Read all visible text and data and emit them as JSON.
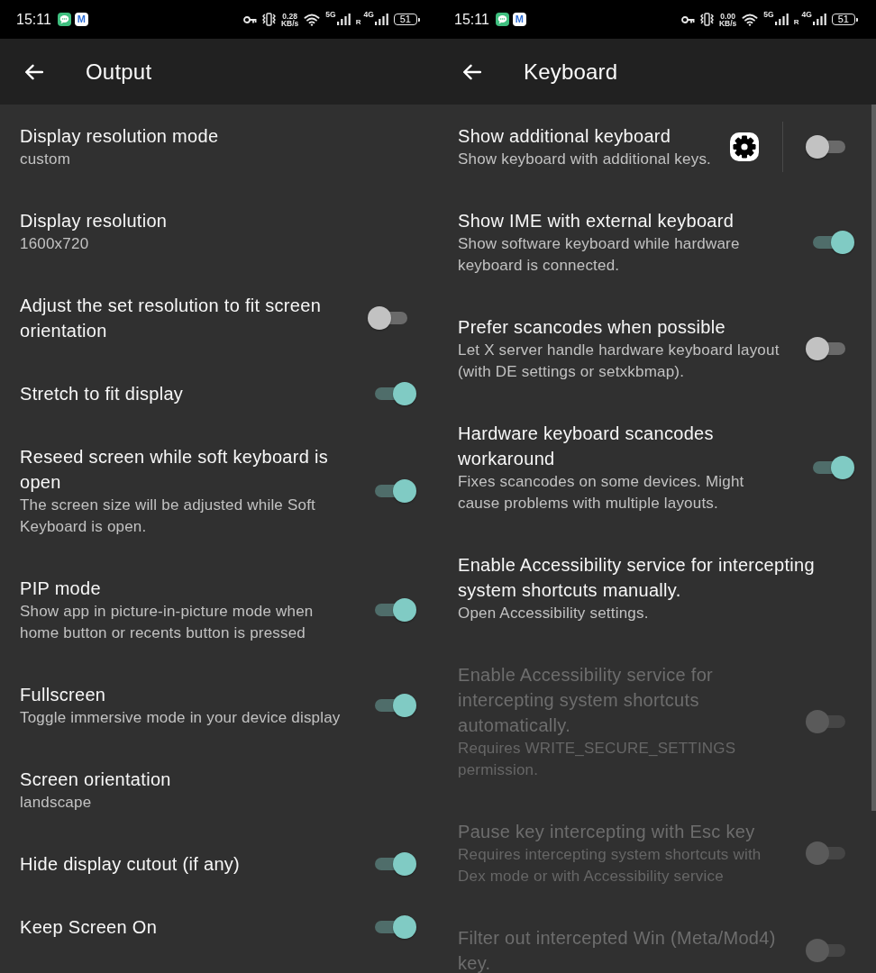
{
  "screens": [
    {
      "status_bar": {
        "time": "15:11",
        "badge_letter": "M",
        "net_speed": "0.28",
        "net_speed_unit": "KB/s",
        "sim_1_network": "5G",
        "roaming": "R",
        "sim_2_network": "4G",
        "battery": "51"
      },
      "app_bar": {
        "title": "Output"
      },
      "settings": [
        {
          "kind": "text",
          "title": "Display resolution mode",
          "summary": "custom",
          "disabled": false
        },
        {
          "kind": "text",
          "title": "Display resolution",
          "summary": "1600x720",
          "disabled": false
        },
        {
          "kind": "switch",
          "title": "Adjust the set resolution to fit screen orientation",
          "on": false,
          "disabled": false
        },
        {
          "kind": "switch",
          "title": "Stretch to fit display",
          "on": true,
          "disabled": false
        },
        {
          "kind": "switch",
          "title": "Reseed screen while soft keyboard is open",
          "summary": "The screen size will be adjusted while Soft Keyboard is open.",
          "on": true,
          "disabled": false
        },
        {
          "kind": "switch",
          "title": "PIP mode",
          "summary": "Show app in picture-in-picture mode when home button or recents button is pressed",
          "on": true,
          "disabled": false
        },
        {
          "kind": "switch",
          "title": "Fullscreen",
          "summary": "Toggle immersive mode in your device display",
          "on": true,
          "disabled": false
        },
        {
          "kind": "text",
          "title": "Screen orientation",
          "summary": "landscape",
          "disabled": false
        },
        {
          "kind": "switch",
          "title": "Hide display cutout (if any)",
          "on": true,
          "disabled": false
        },
        {
          "kind": "switch",
          "title": "Keep Screen On",
          "on": true,
          "disabled": false
        }
      ]
    },
    {
      "status_bar": {
        "time": "15:11",
        "badge_letter": "M",
        "net_speed": "0.00",
        "net_speed_unit": "KB/s",
        "sim_1_network": "5G",
        "roaming": "R",
        "sim_2_network": "4G",
        "battery": "51"
      },
      "app_bar": {
        "title": "Keyboard"
      },
      "scrollbar": true,
      "settings": [
        {
          "kind": "gear_switch",
          "title": "Show additional keyboard",
          "summary": "Show keyboard with additional keys.",
          "on": false,
          "disabled": false
        },
        {
          "kind": "switch",
          "title": "Show IME with external keyboard",
          "summary": "Show software keyboard while hardware keyboard is connected.",
          "on": true,
          "disabled": false
        },
        {
          "kind": "switch",
          "title": "Prefer scancodes when possible",
          "summary": "Let X server handle hardware keyboard layout (with DE settings or setxkbmap).",
          "on": false,
          "disabled": false
        },
        {
          "kind": "switch",
          "title": "Hardware keyboard scancodes workaround",
          "summary": "Fixes scancodes on some devices. Might cause problems with multiple layouts.",
          "on": true,
          "disabled": false
        },
        {
          "kind": "text",
          "title": "Enable Accessibility service for intercepting system shortcuts manually.",
          "summary": "Open Accessibility settings.",
          "disabled": false
        },
        {
          "kind": "switch",
          "title": "Enable Accessibility service for intercepting system shortcuts automatically.",
          "summary": "Requires WRITE_SECURE_SETTINGS permission.",
          "on": false,
          "disabled": true
        },
        {
          "kind": "switch",
          "title": "Pause key intercepting with Esc key",
          "summary": "Requires intercepting system shortcuts with Dex mode or with Accessibility service",
          "on": false,
          "disabled": true
        },
        {
          "kind": "switch",
          "title": "Filter out intercepted Win (Meta/Mod4) key.",
          "on": false,
          "disabled": true
        }
      ]
    }
  ]
}
